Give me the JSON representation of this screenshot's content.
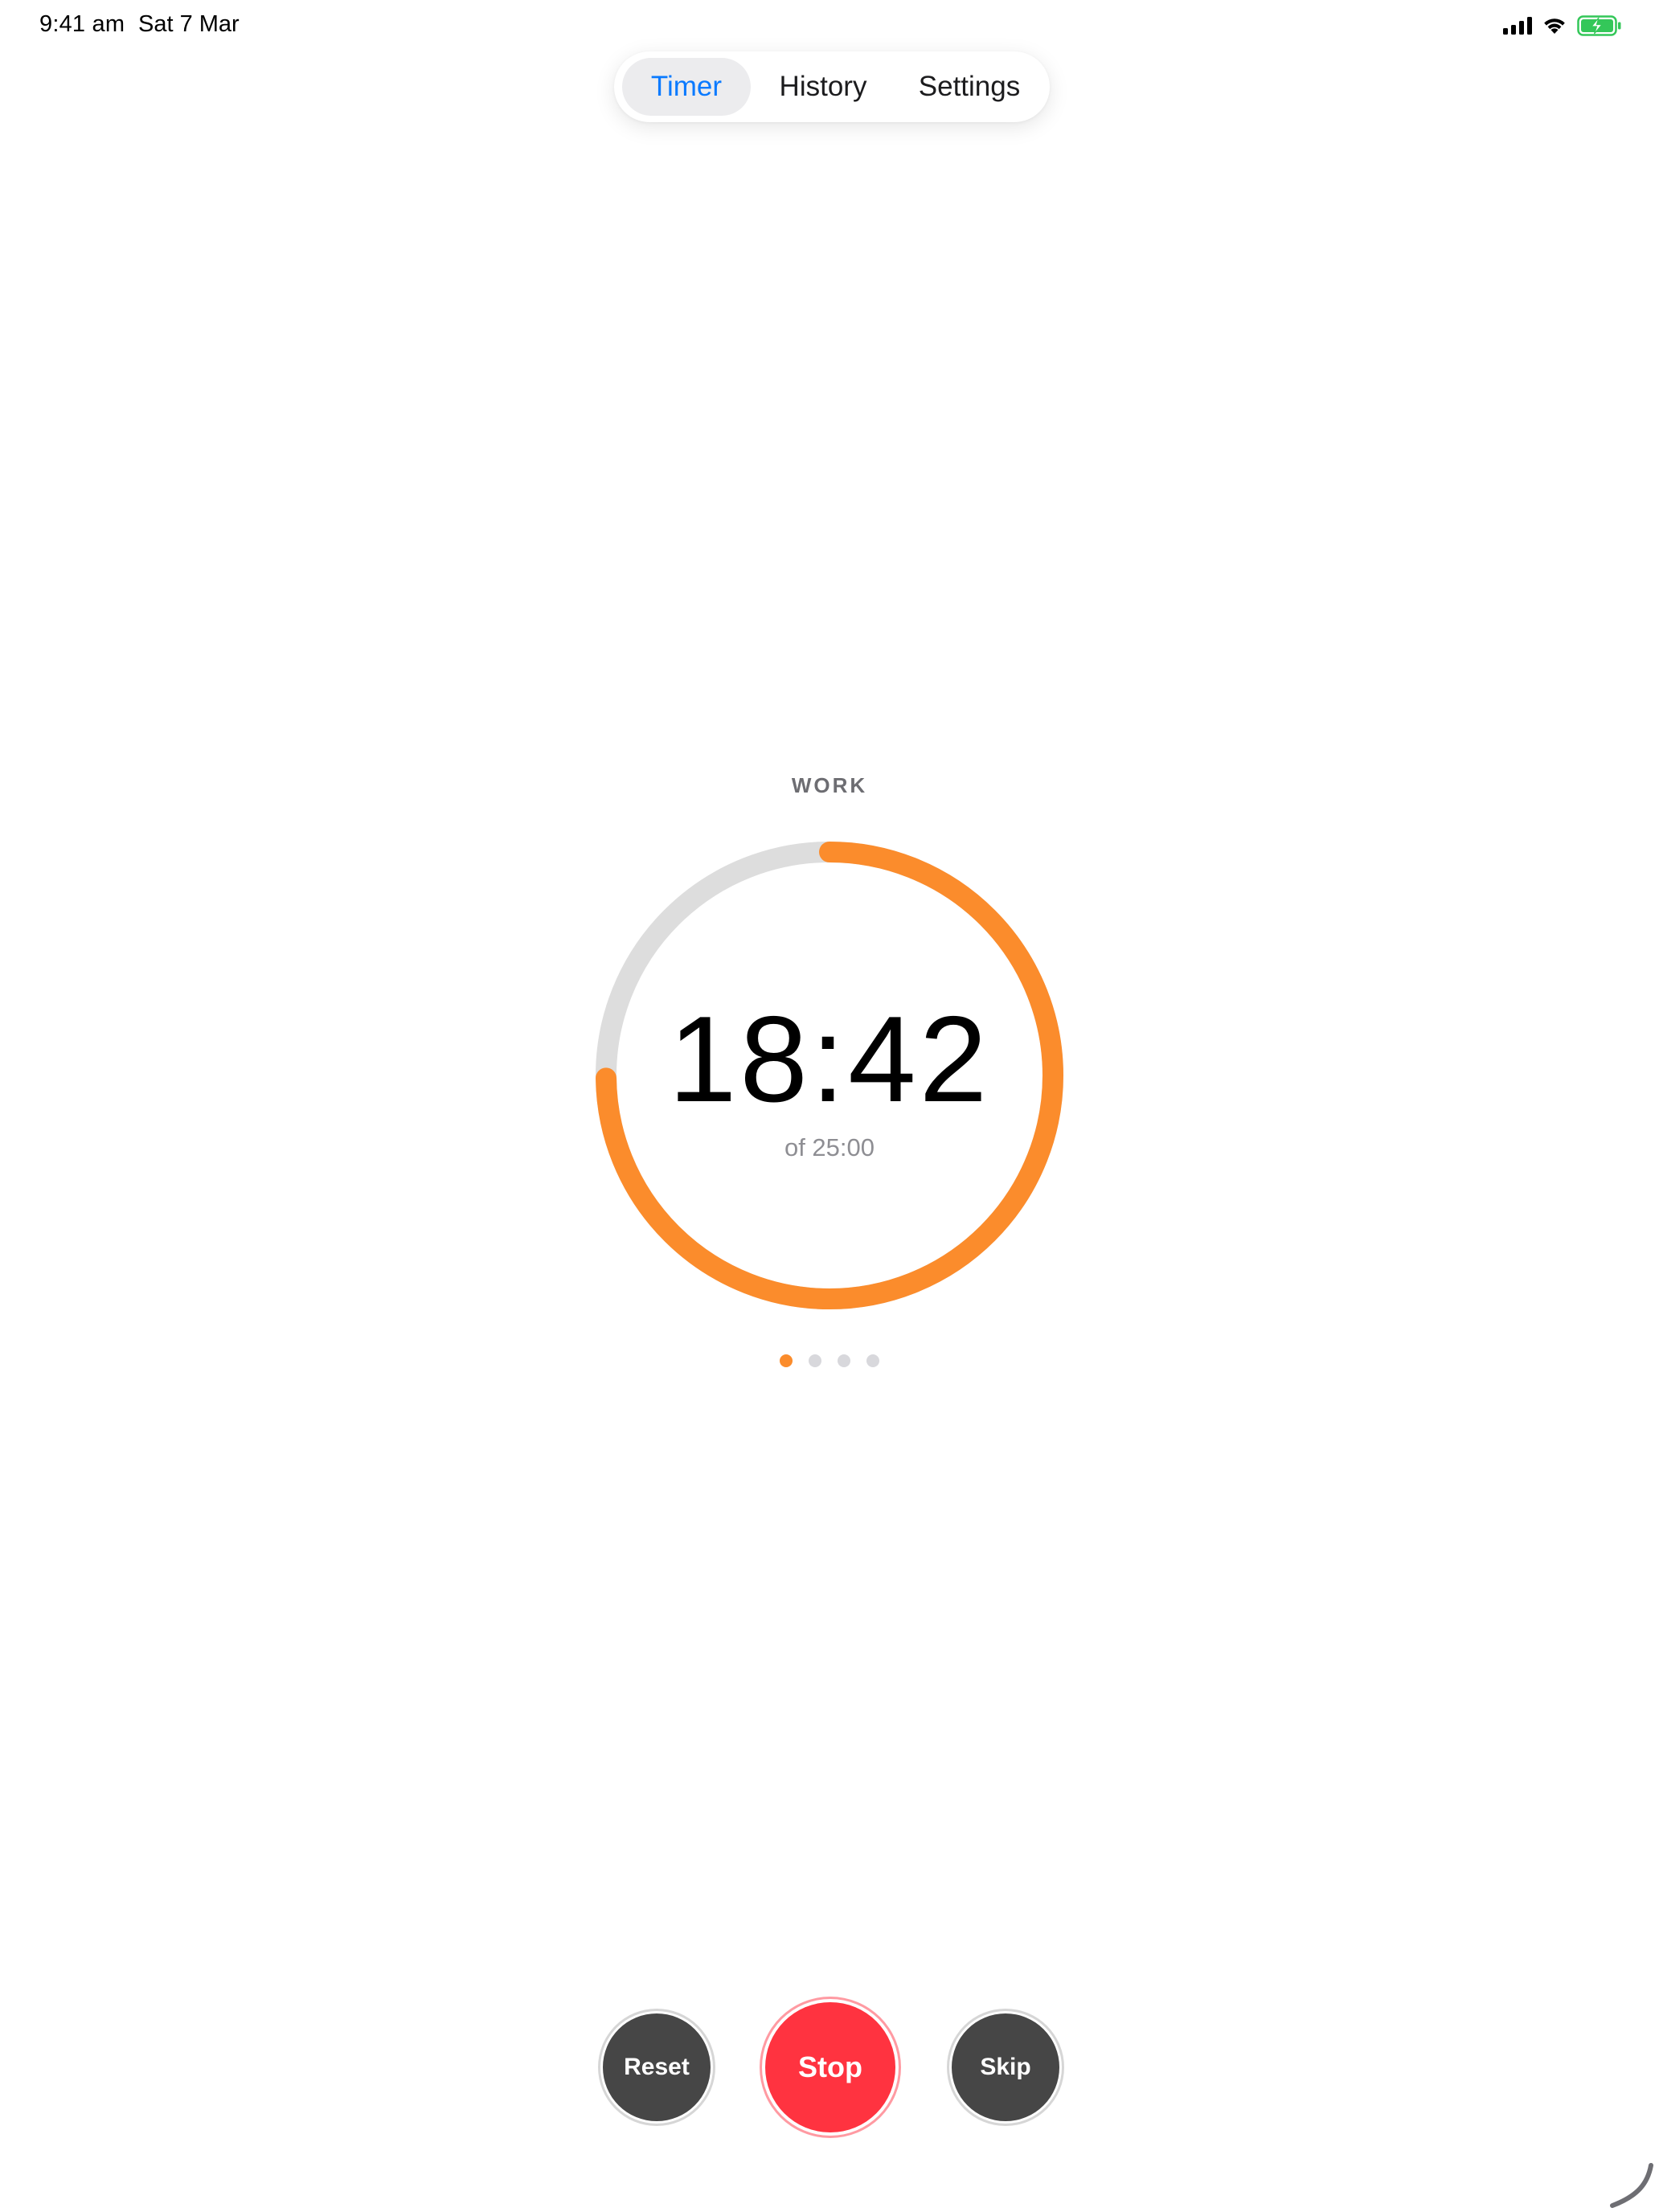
{
  "status_bar": {
    "time": "9:41 am",
    "date": "Sat 7 Mar",
    "icons": [
      "cellular-signal-icon",
      "wifi-icon",
      "battery-charging-icon"
    ]
  },
  "tabs": [
    {
      "label": "Timer",
      "selected": true
    },
    {
      "label": "History",
      "selected": false
    },
    {
      "label": "Settings",
      "selected": false
    }
  ],
  "timer": {
    "phase": "WORK",
    "remaining": "18:42",
    "total_label": "of 25:00",
    "progress_remaining_fraction": 0.748,
    "ring_color": "#fb8c2c",
    "track_color": "#dddddd"
  },
  "session_dots": {
    "count": 4,
    "current_index": 0,
    "active_color": "#fb8c2c",
    "inactive_color": "#d8d8dc"
  },
  "controls": {
    "reset_label": "Reset",
    "stop_label": "Stop",
    "skip_label": "Skip",
    "stop_color": "#ff3340",
    "secondary_color": "#464646"
  },
  "colors": {
    "accent": "#0a7aff",
    "battery_green": "#34c759"
  }
}
